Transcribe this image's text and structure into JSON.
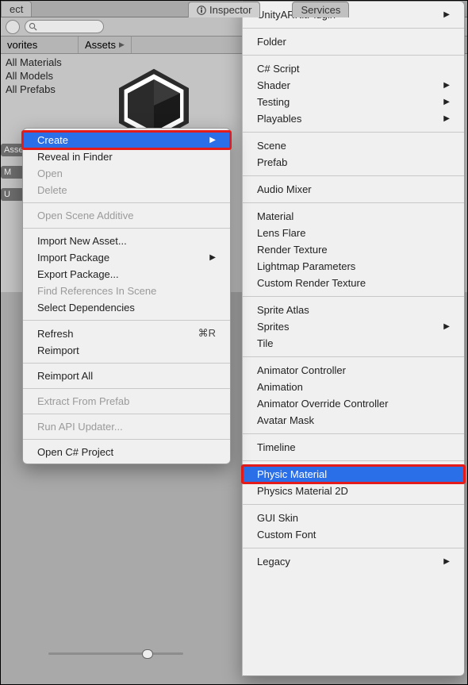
{
  "tabs": {
    "project": "ect",
    "inspector": "Inspector",
    "services": "Services"
  },
  "toolbar": {
    "search_placeholder": ""
  },
  "breadcrumbs": {
    "favorites": "vorites",
    "assets": "Assets"
  },
  "favorites_list": [
    "All Materials",
    "All Models",
    "All Prefabs"
  ],
  "left_sections": {
    "assets": "Assets",
    "m": "M",
    "u": "U"
  },
  "context_menu": [
    {
      "label": "Create",
      "selected": true,
      "submenu": true,
      "redbox": true
    },
    {
      "label": "Reveal in Finder"
    },
    {
      "label": "Open",
      "disabled": true
    },
    {
      "label": "Delete",
      "disabled": true
    },
    {
      "sep": true
    },
    {
      "label": "Open Scene Additive",
      "disabled": true
    },
    {
      "sep": true
    },
    {
      "label": "Import New Asset..."
    },
    {
      "label": "Import Package",
      "submenu": true
    },
    {
      "label": "Export Package..."
    },
    {
      "label": "Find References In Scene",
      "disabled": true
    },
    {
      "label": "Select Dependencies"
    },
    {
      "sep": true
    },
    {
      "label": "Refresh",
      "shortcut": "⌘R"
    },
    {
      "label": "Reimport"
    },
    {
      "sep": true
    },
    {
      "label": "Reimport All"
    },
    {
      "sep": true
    },
    {
      "label": "Extract From Prefab",
      "disabled": true
    },
    {
      "sep": true
    },
    {
      "label": "Run API Updater...",
      "disabled": true
    },
    {
      "sep": true
    },
    {
      "label": "Open C# Project"
    }
  ],
  "create_submenu": [
    {
      "label": "UnityARKitPlugin",
      "submenu": true
    },
    {
      "sep": true
    },
    {
      "label": "Folder"
    },
    {
      "sep": true
    },
    {
      "label": "C# Script"
    },
    {
      "label": "Shader",
      "submenu": true
    },
    {
      "label": "Testing",
      "submenu": true
    },
    {
      "label": "Playables",
      "submenu": true
    },
    {
      "sep": true
    },
    {
      "label": "Scene"
    },
    {
      "label": "Prefab"
    },
    {
      "sep": true
    },
    {
      "label": "Audio Mixer"
    },
    {
      "sep": true
    },
    {
      "label": "Material"
    },
    {
      "label": "Lens Flare"
    },
    {
      "label": "Render Texture"
    },
    {
      "label": "Lightmap Parameters"
    },
    {
      "label": "Custom Render Texture"
    },
    {
      "sep": true
    },
    {
      "label": "Sprite Atlas"
    },
    {
      "label": "Sprites",
      "submenu": true
    },
    {
      "label": "Tile"
    },
    {
      "sep": true
    },
    {
      "label": "Animator Controller"
    },
    {
      "label": "Animation"
    },
    {
      "label": "Animator Override Controller"
    },
    {
      "label": "Avatar Mask"
    },
    {
      "sep": true
    },
    {
      "label": "Timeline"
    },
    {
      "sep": true
    },
    {
      "label": "Physic Material",
      "selected": true,
      "redbox": true
    },
    {
      "label": "Physics Material 2D"
    },
    {
      "sep": true
    },
    {
      "label": "GUI Skin"
    },
    {
      "label": "Custom Font"
    },
    {
      "sep": true
    },
    {
      "label": "Legacy",
      "submenu": true
    }
  ]
}
